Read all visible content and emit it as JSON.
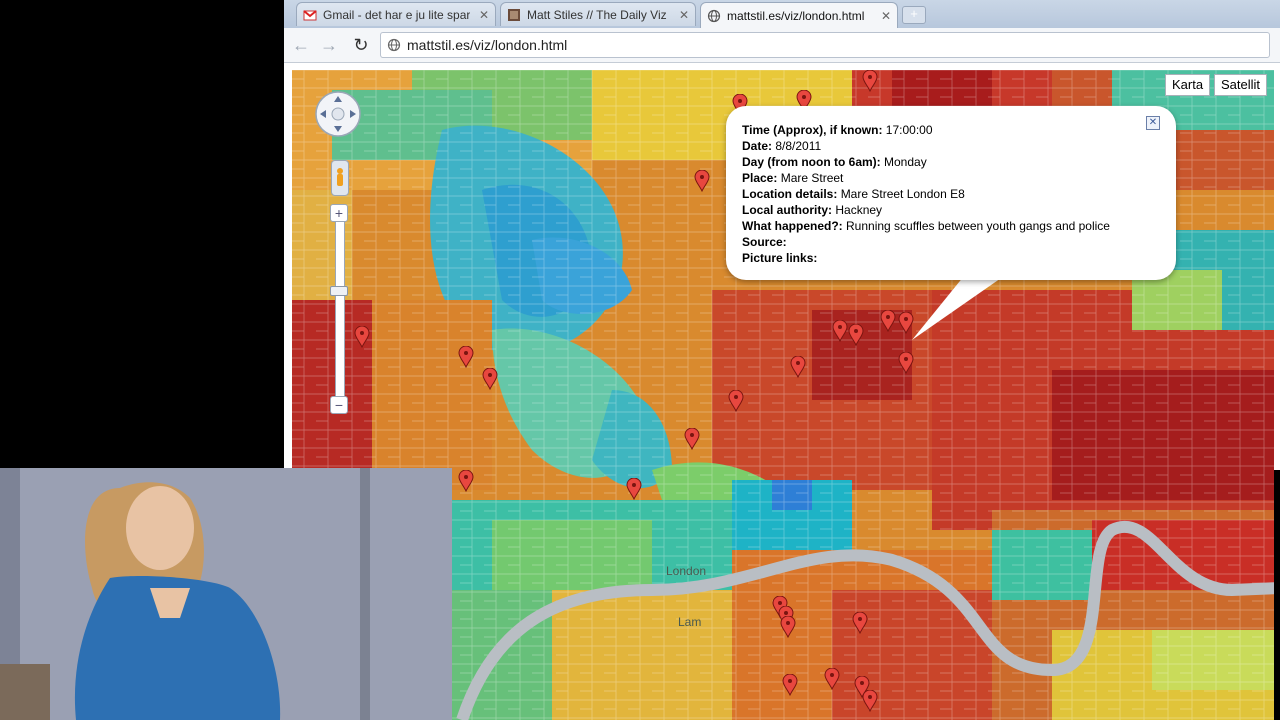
{
  "browser": {
    "tabs": [
      {
        "title": "Gmail - det har e ju lite spar",
        "active": false,
        "icon": "gmail-icon"
      },
      {
        "title": "Matt Stiles // The Daily Viz",
        "active": false,
        "icon": "blog-icon"
      },
      {
        "title": "mattstil.es/viz/london.html",
        "active": true,
        "icon": "globe-icon"
      }
    ],
    "url": "mattstil.es/viz/london.html"
  },
  "map": {
    "type_buttons": [
      "Karta",
      "Satellit"
    ],
    "place_labels": [
      "London",
      "Lam"
    ],
    "info_window": {
      "rows": [
        {
          "label": "Time (Approx), if known:",
          "value": "17:00:00"
        },
        {
          "label": "Date:",
          "value": "8/8/2011"
        },
        {
          "label": "Day (from noon to 6am):",
          "value": "Monday"
        },
        {
          "label": "Place:",
          "value": "Mare Street"
        },
        {
          "label": "Location details:",
          "value": "Mare Street London E8"
        },
        {
          "label": "Local authority:",
          "value": "Hackney"
        },
        {
          "label": "What happened?:",
          "value": "Running scuffles between youth gangs and police"
        },
        {
          "label": "Source:",
          "value": ""
        },
        {
          "label": "Picture links:",
          "value": ""
        }
      ]
    }
  },
  "colors": {
    "choropleth_low": "#2bb3c9",
    "choropleth_mid": "#e8c83a",
    "choropleth_high": "#b41f1f",
    "marker": "#e8473f",
    "river": "#b9bec4"
  }
}
